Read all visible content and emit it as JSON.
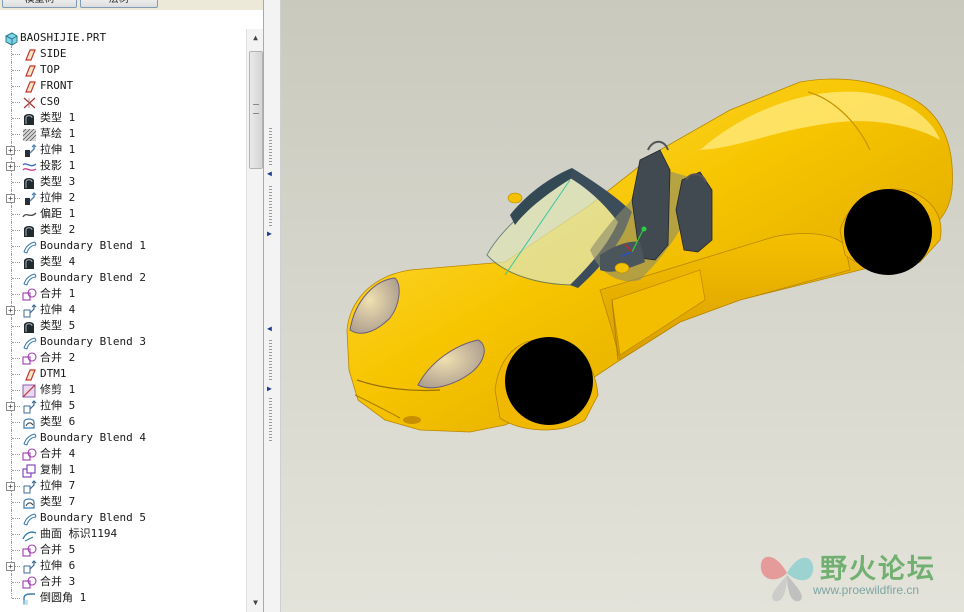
{
  "tabs": [
    "模型树",
    "层树"
  ],
  "tree": {
    "root": {
      "label": "BAOSHIJIE.PRT",
      "icon": "part-icon"
    },
    "items": [
      {
        "label": "SIDE",
        "icon": "datum-plane-icon",
        "expand": false
      },
      {
        "label": "TOP",
        "icon": "datum-plane-icon",
        "expand": false
      },
      {
        "label": "FRONT",
        "icon": "datum-plane-icon",
        "expand": false
      },
      {
        "label": "CS0",
        "icon": "coordinate-system-icon",
        "expand": false
      },
      {
        "label": "类型 1",
        "icon": "style-feature-icon",
        "expand": false
      },
      {
        "label": "草绘 1",
        "icon": "sketch-icon",
        "expand": false
      },
      {
        "label": "拉伸 1",
        "icon": "extrude-icon",
        "expand": true
      },
      {
        "label": "投影 1",
        "icon": "projection-icon",
        "expand": true
      },
      {
        "label": "类型 3",
        "icon": "style-feature-icon",
        "expand": false
      },
      {
        "label": "拉伸 2",
        "icon": "extrude-icon",
        "expand": true
      },
      {
        "label": "偏距 1",
        "icon": "offset-curve-icon",
        "expand": false
      },
      {
        "label": "类型 2",
        "icon": "style-feature-icon",
        "expand": false
      },
      {
        "label": "Boundary Blend 1",
        "icon": "boundary-blend-icon",
        "expand": false
      },
      {
        "label": "类型 4",
        "icon": "style-feature-icon",
        "expand": false
      },
      {
        "label": "Boundary Blend 2",
        "icon": "boundary-blend-icon",
        "expand": false
      },
      {
        "label": "合并 1",
        "icon": "merge-icon",
        "expand": false
      },
      {
        "label": "拉伸 4",
        "icon": "extrude-surface-icon",
        "expand": true
      },
      {
        "label": "类型 5",
        "icon": "style-feature-icon",
        "expand": false
      },
      {
        "label": "Boundary Blend 3",
        "icon": "boundary-blend-icon",
        "expand": false
      },
      {
        "label": "合并 2",
        "icon": "merge-icon",
        "expand": false
      },
      {
        "label": "DTM1",
        "icon": "datum-plane-icon",
        "expand": false
      },
      {
        "label": "修剪 1",
        "icon": "trim-icon",
        "expand": false
      },
      {
        "label": "拉伸 5",
        "icon": "extrude-surface-icon",
        "expand": true
      },
      {
        "label": "类型 6",
        "icon": "style-curve-icon",
        "expand": false
      },
      {
        "label": "Boundary Blend 4",
        "icon": "boundary-blend-icon",
        "expand": false
      },
      {
        "label": "合并 4",
        "icon": "merge-icon",
        "expand": false
      },
      {
        "label": "复制 1",
        "icon": "copy-icon",
        "expand": false
      },
      {
        "label": "拉伸 7",
        "icon": "extrude-surface-icon",
        "expand": true
      },
      {
        "label": "类型 7",
        "icon": "style-curve-icon",
        "expand": false
      },
      {
        "label": "Boundary Blend 5",
        "icon": "boundary-blend-icon",
        "expand": false
      },
      {
        "label": "曲面 标识1194",
        "icon": "surface-icon",
        "expand": false
      },
      {
        "label": "合并 5",
        "icon": "merge-icon",
        "expand": false
      },
      {
        "label": "拉伸 6",
        "icon": "extrude-surface-icon",
        "expand": true
      },
      {
        "label": "合并 3",
        "icon": "merge-icon",
        "expand": false
      },
      {
        "label": "倒圆角 1",
        "icon": "round-icon",
        "expand": false
      }
    ]
  },
  "viewport": {
    "model": "yellow-convertible-car-model",
    "background_top": "#c9c9bd",
    "background_bottom": "#e3e3da",
    "body_color": "#f5c400"
  },
  "watermark": {
    "title": "野火论坛",
    "url": "www.proewildfire.cn"
  },
  "colors": {
    "tree_text": "#1a1a1a",
    "sash_arrow": "#1c3d8c"
  }
}
